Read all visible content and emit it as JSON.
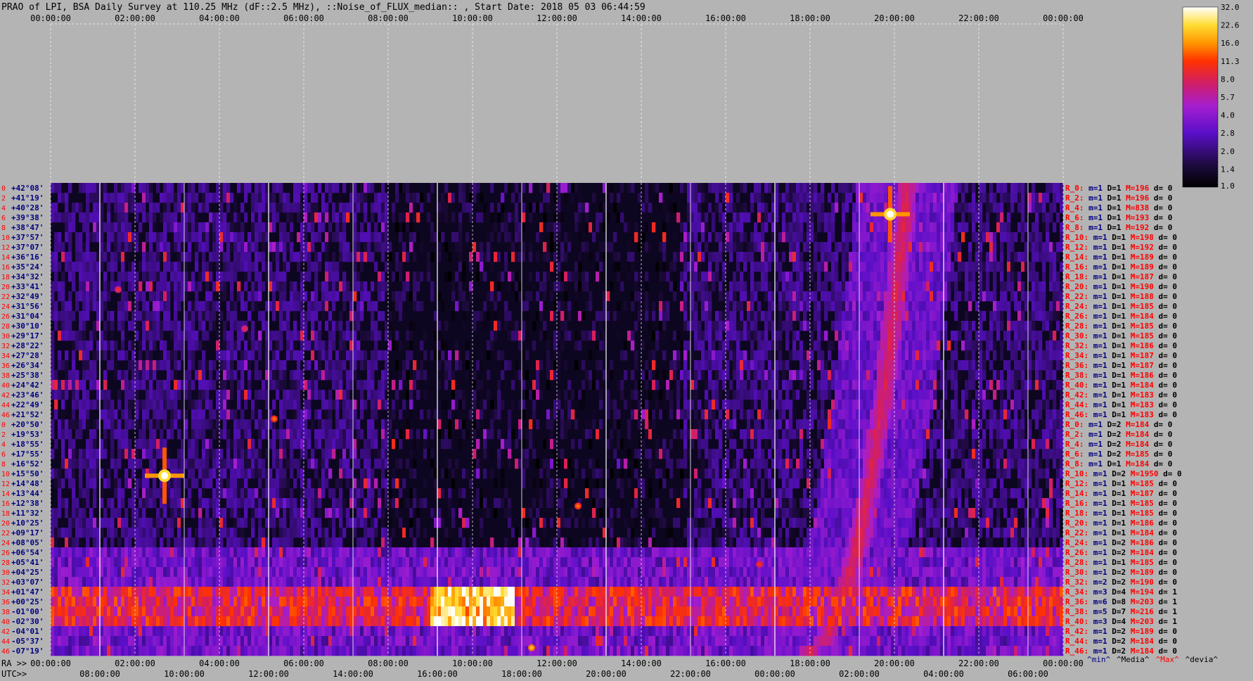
{
  "header": {
    "title": "PRAO of LPI, BSA Daily Survey at 110.25 MHz (dF::2.5 MHz), ::Noise_of_FLUX_median:: , Start Date: 2018 05 03 06:44:59"
  },
  "colors": {
    "background": "#b4b4b4",
    "grid": "#e6e6e6",
    "dec_label": "#000080",
    "row_index": "#ff0000",
    "ra_label": "#ff0000",
    "ra_min": "#000080",
    "ra_max": "#ff0000",
    "axis_text": "#000000"
  },
  "chart_data": {
    "type": "heatmap",
    "colorscale": "black-purple-red-yellow-white",
    "colorbar": {
      "ticks": [
        "32.0",
        "22.6",
        "16.0",
        "11.3",
        "8.0",
        "5.7",
        "4.0",
        "2.8",
        "2.0",
        "1.4",
        "1.0"
      ]
    },
    "top_axis": {
      "ticks": [
        "00:00:00",
        "02:00:00",
        "04:00:00",
        "06:00:00",
        "08:00:00",
        "10:00:00",
        "12:00:00",
        "14:00:00",
        "16:00:00",
        "18:00:00",
        "20:00:00",
        "22:00:00",
        "00:00:00"
      ]
    },
    "ra_axis": {
      "label": "RA >>",
      "ticks": [
        "00:00:00",
        "02:00:00",
        "04:00:00",
        "06:00:00",
        "08:00:00",
        "10:00:00",
        "12:00:00",
        "14:00:00",
        "16:00:00",
        "18:00:00",
        "20:00:00",
        "22:00:00",
        "00:00:00"
      ]
    },
    "utc_axis": {
      "label": "UTC>>",
      "ticks": [
        "08:00:00",
        "10:00:00",
        "12:00:00",
        "14:00:00",
        "16:00:00",
        "18:00:00",
        "20:00:00",
        "22:00:00",
        "00:00:00",
        "02:00:00",
        "04:00:00",
        "06:00:00"
      ]
    },
    "legend_keys": [
      {
        "label": "^min^",
        "color": "#000080"
      },
      {
        "label": "^Media^",
        "color": "#000000"
      },
      {
        "label": "^Max^",
        "color": "#ff0000"
      },
      {
        "label": "^devia^",
        "color": "#000000"
      }
    ],
    "declinations": [
      "+42°08'",
      "+41°19'",
      "+40°28'",
      "+39°38'",
      "+38°47'",
      "+37°57'",
      "+37°07'",
      "+36°16'",
      "+35°24'",
      "+34°32'",
      "+33°41'",
      "+32°49'",
      "+31°56'",
      "+31°04'",
      "+30°10'",
      "+29°17'",
      "+28°22'",
      "+27°28'",
      "+26°34'",
      "+25°38'",
      "+24°42'",
      "+23°46'",
      "+22°49'",
      "+21°52'",
      "+20°50'",
      "+19°53'",
      "+18°55'",
      "+17°55'",
      "+16°52'",
      "+15°50'",
      "+14°48'",
      "+13°44'",
      "+12°38'",
      "+11°32'",
      "+10°25'",
      "+09°17'",
      "+08°05'",
      "+06°54'",
      "+05°41'",
      "+04°25'",
      "+03°07'",
      "+01°47'",
      "+00°25'",
      "-01°00'",
      "-02°30'",
      "-04°01'",
      "-05°37'",
      "-07°19'"
    ],
    "row_indices": [
      "0",
      "2",
      "4",
      "6",
      "8",
      "10",
      "12",
      "14",
      "16",
      "18",
      "20",
      "22",
      "24",
      "26",
      "28",
      "30",
      "32",
      "34",
      "36",
      "38",
      "40",
      "42",
      "44",
      "46",
      "0",
      "2",
      "4",
      "6",
      "8",
      "10",
      "12",
      "14",
      "16",
      "18",
      "20",
      "22",
      "24",
      "26",
      "28",
      "30",
      "32",
      "34",
      "36",
      "38",
      "40",
      "42",
      "44",
      "46"
    ],
    "receivers": [
      {
        "r": "R_0:",
        "m": "m=1",
        "D": "D=1",
        "M": "M=196",
        "d": "d= 0"
      },
      {
        "r": "R_2:",
        "m": "m=1",
        "D": "D=1",
        "M": "M=196",
        "d": "d= 0"
      },
      {
        "r": "R_4:",
        "m": "m=1",
        "D": "D=1",
        "M": "M=838",
        "d": "d= 0"
      },
      {
        "r": "R_6:",
        "m": "m=1",
        "D": "D=1",
        "M": "M=193",
        "d": "d= 0"
      },
      {
        "r": "R_8:",
        "m": "m=1",
        "D": "D=1",
        "M": "M=192",
        "d": "d= 0"
      },
      {
        "r": "R_10:",
        "m": "m=1",
        "D": "D=1",
        "M": "M=198",
        "d": "d= 0"
      },
      {
        "r": "R_12:",
        "m": "m=1",
        "D": "D=1",
        "M": "M=192",
        "d": "d= 0"
      },
      {
        "r": "R_14:",
        "m": "m=1",
        "D": "D=1",
        "M": "M=189",
        "d": "d= 0"
      },
      {
        "r": "R_16:",
        "m": "m=1",
        "D": "D=1",
        "M": "M=189",
        "d": "d= 0"
      },
      {
        "r": "R_18:",
        "m": "m=1",
        "D": "D=1",
        "M": "M=187",
        "d": "d= 0"
      },
      {
        "r": "R_20:",
        "m": "m=1",
        "D": "D=1",
        "M": "M=190",
        "d": "d= 0"
      },
      {
        "r": "R_22:",
        "m": "m=1",
        "D": "D=1",
        "M": "M=188",
        "d": "d= 0"
      },
      {
        "r": "R_24:",
        "m": "m=1",
        "D": "D=1",
        "M": "M=185",
        "d": "d= 0"
      },
      {
        "r": "R_26:",
        "m": "m=1",
        "D": "D=1",
        "M": "M=184",
        "d": "d= 0"
      },
      {
        "r": "R_28:",
        "m": "m=1",
        "D": "D=1",
        "M": "M=185",
        "d": "d= 0"
      },
      {
        "r": "R_30:",
        "m": "m=1",
        "D": "D=1",
        "M": "M=185",
        "d": "d= 0"
      },
      {
        "r": "R_32:",
        "m": "m=1",
        "D": "D=1",
        "M": "M=186",
        "d": "d= 0"
      },
      {
        "r": "R_34:",
        "m": "m=1",
        "D": "D=1",
        "M": "M=187",
        "d": "d= 0"
      },
      {
        "r": "R_36:",
        "m": "m=1",
        "D": "D=1",
        "M": "M=187",
        "d": "d= 0"
      },
      {
        "r": "R_38:",
        "m": "m=1",
        "D": "D=1",
        "M": "M=186",
        "d": "d= 0"
      },
      {
        "r": "R_40:",
        "m": "m=1",
        "D": "D=1",
        "M": "M=184",
        "d": "d= 0"
      },
      {
        "r": "R_42:",
        "m": "m=1",
        "D": "D=1",
        "M": "M=183",
        "d": "d= 0"
      },
      {
        "r": "R_44:",
        "m": "m=1",
        "D": "D=1",
        "M": "M=183",
        "d": "d= 0"
      },
      {
        "r": "R_46:",
        "m": "m=1",
        "D": "D=1",
        "M": "M=183",
        "d": "d= 0"
      },
      {
        "r": "R_0:",
        "m": "m=1",
        "D": "D=2",
        "M": "M=184",
        "d": "d= 0"
      },
      {
        "r": "R_2:",
        "m": "m=1",
        "D": "D=2",
        "M": "M=184",
        "d": "d= 0"
      },
      {
        "r": "R_4:",
        "m": "m=1",
        "D": "D=2",
        "M": "M=184",
        "d": "d= 0"
      },
      {
        "r": "R_6:",
        "m": "m=1",
        "D": "D=2",
        "M": "M=185",
        "d": "d= 0"
      },
      {
        "r": "R_8:",
        "m": "m=1",
        "D": "D=1",
        "M": "M=184",
        "d": "d= 0"
      },
      {
        "r": "R_10:",
        "m": "m=1",
        "D": "D=2",
        "M": "M=1950",
        "d": "d= 0"
      },
      {
        "r": "R_12:",
        "m": "m=1",
        "D": "D=1",
        "M": "M=185",
        "d": "d= 0"
      },
      {
        "r": "R_14:",
        "m": "m=1",
        "D": "D=1",
        "M": "M=187",
        "d": "d= 0"
      },
      {
        "r": "R_16:",
        "m": "m=1",
        "D": "D=1",
        "M": "M=185",
        "d": "d= 0"
      },
      {
        "r": "R_18:",
        "m": "m=1",
        "D": "D=1",
        "M": "M=185",
        "d": "d= 0"
      },
      {
        "r": "R_20:",
        "m": "m=1",
        "D": "D=1",
        "M": "M=186",
        "d": "d= 0"
      },
      {
        "r": "R_22:",
        "m": "m=1",
        "D": "D=1",
        "M": "M=184",
        "d": "d= 0"
      },
      {
        "r": "R_24:",
        "m": "m=1",
        "D": "D=2",
        "M": "M=186",
        "d": "d= 0"
      },
      {
        "r": "R_26:",
        "m": "m=1",
        "D": "D=2",
        "M": "M=184",
        "d": "d= 0"
      },
      {
        "r": "R_28:",
        "m": "m=1",
        "D": "D=1",
        "M": "M=185",
        "d": "d= 0"
      },
      {
        "r": "R_30:",
        "m": "m=1",
        "D": "D=2",
        "M": "M=189",
        "d": "d= 0"
      },
      {
        "r": "R_32:",
        "m": "m=2",
        "D": "D=2",
        "M": "M=190",
        "d": "d= 0"
      },
      {
        "r": "R_34:",
        "m": "m=3",
        "D": "D=4",
        "M": "M=194",
        "d": "d= 1"
      },
      {
        "r": "R_36:",
        "m": "m=6",
        "D": "D=8",
        "M": "M=203",
        "d": "d= 1"
      },
      {
        "r": "R_38:",
        "m": "m=5",
        "D": "D=7",
        "M": "M=216",
        "d": "d= 1"
      },
      {
        "r": "R_40:",
        "m": "m=3",
        "D": "D=4",
        "M": "M=203",
        "d": "d= 1"
      },
      {
        "r": "R_42:",
        "m": "m=1",
        "D": "D=2",
        "M": "M=189",
        "d": "d= 0"
      },
      {
        "r": "R_44:",
        "m": "m=1",
        "D": "D=2",
        "M": "M=184",
        "d": "d= 0"
      },
      {
        "r": "R_46:",
        "m": "m=1",
        "D": "D=2",
        "M": "M=184",
        "d": "d= 0"
      }
    ],
    "features": [
      {
        "kind": "equatorial-band",
        "ra_h": [
          0,
          24
        ],
        "dec": [
          -3,
          3
        ],
        "level": 9
      },
      {
        "kind": "bright-spot",
        "ra_h": 2.7,
        "dec": 15.6,
        "level": 32
      },
      {
        "kind": "bright-spot",
        "ra_h": 19.9,
        "dec": 39.9,
        "level": 32
      },
      {
        "kind": "bright-spot",
        "ra_h": 5.3,
        "dec": 21.4,
        "level": 14
      },
      {
        "kind": "bright-spot",
        "ra_h": 12.5,
        "dec": 12.3,
        "level": 14
      },
      {
        "kind": "bright-spot",
        "ra_h": 1.6,
        "dec": 33.4,
        "level": 10
      },
      {
        "kind": "bright-spot",
        "ra_h": 4.6,
        "dec": 29.9,
        "level": 9
      },
      {
        "kind": "bright-spot",
        "ra_h": 16.8,
        "dec": 5.4,
        "level": 11
      },
      {
        "kind": "bright-spot",
        "ra_h": 11.4,
        "dec": -6.8,
        "level": 20
      },
      {
        "kind": "bright-region",
        "ra_h": [
          9.0,
          11.0
        ],
        "dec": [
          -3,
          2
        ],
        "level": 26
      },
      {
        "kind": "galactic-plane",
        "ra_h": [
          18.0,
          20.3
        ],
        "dec": [
          -7.3,
          42
        ],
        "level": 7
      }
    ]
  }
}
